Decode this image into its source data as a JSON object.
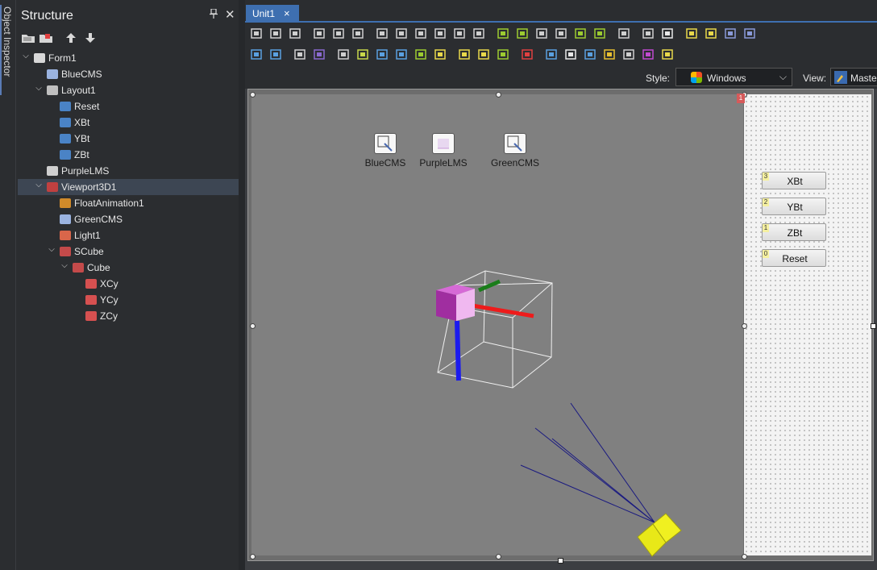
{
  "side_strip": {
    "label": "Object Inspector"
  },
  "structure": {
    "title": "Structure",
    "pin_icon": "pin-icon",
    "close_icon": "close-icon",
    "toolbar": [
      "open-folder-icon",
      "folder-props-icon",
      "move-up-icon",
      "move-down-icon"
    ],
    "tree": [
      {
        "label": "Form1",
        "level": 0,
        "expand": "open",
        "icon": "form-icon",
        "color": "#d8d8d8"
      },
      {
        "label": "BlueCMS",
        "level": 1,
        "expand": "none",
        "icon": "cms-icon",
        "color": "#9ab3e0"
      },
      {
        "label": "Layout1",
        "level": 1,
        "expand": "open",
        "icon": "layout-icon",
        "color": "#bfbfbf"
      },
      {
        "label": "Reset",
        "level": 2,
        "expand": "none",
        "icon": "button-icon",
        "color": "#4a83c6"
      },
      {
        "label": "XBt",
        "level": 2,
        "expand": "none",
        "icon": "button-icon",
        "color": "#4a83c6"
      },
      {
        "label": "YBt",
        "level": 2,
        "expand": "none",
        "icon": "button-icon",
        "color": "#4a83c6"
      },
      {
        "label": "ZBt",
        "level": 2,
        "expand": "none",
        "icon": "button-icon",
        "color": "#4a83c6"
      },
      {
        "label": "PurpleLMS",
        "level": 1,
        "expand": "none",
        "icon": "checker-icon",
        "color": "#cfcfcf"
      },
      {
        "label": "Viewport3D1",
        "level": 1,
        "expand": "open",
        "icon": "viewport-icon",
        "color": "#c04040",
        "selected": true
      },
      {
        "label": "FloatAnimation1",
        "level": 2,
        "expand": "none",
        "icon": "animation-icon",
        "color": "#d08a2a"
      },
      {
        "label": "GreenCMS",
        "level": 2,
        "expand": "none",
        "icon": "cms-icon",
        "color": "#9ab3e0"
      },
      {
        "label": "Light1",
        "level": 2,
        "expand": "none",
        "icon": "light-icon",
        "color": "#d9664a"
      },
      {
        "label": "SCube",
        "level": 2,
        "expand": "open",
        "icon": "sphere-icon",
        "color": "#c44a4a"
      },
      {
        "label": "Cube",
        "level": 3,
        "expand": "open",
        "icon": "cube-icon",
        "color": "#c44a4a"
      },
      {
        "label": "XCy",
        "level": 4,
        "expand": "none",
        "icon": "cube-icon",
        "color": "#d65050"
      },
      {
        "label": "YCy",
        "level": 4,
        "expand": "none",
        "icon": "cube-icon",
        "color": "#d65050"
      },
      {
        "label": "ZCy",
        "level": 4,
        "expand": "none",
        "icon": "cube-icon",
        "color": "#d65050"
      }
    ]
  },
  "editor": {
    "tab": {
      "label": "Unit1",
      "close": "×"
    },
    "toolbar_row1": [
      {
        "name": "align-left-icon",
        "color": "#cfcfcf"
      },
      {
        "name": "align-right-icon",
        "color": "#cfcfcf"
      },
      {
        "name": "align-center-icon",
        "color": "#cfcfcf"
      },
      {
        "name": "align-top-icon",
        "color": "#cfcfcf"
      },
      {
        "name": "align-bottom-icon",
        "color": "#cfcfcf"
      },
      {
        "name": "align-middle-icon",
        "color": "#cfcfcf"
      },
      {
        "name": "space-h-icon",
        "color": "#cfcfcf"
      },
      {
        "name": "space-h-inc-icon",
        "color": "#cfcfcf"
      },
      {
        "name": "space-h-dec-icon",
        "color": "#cfcfcf"
      },
      {
        "name": "space-v-icon",
        "color": "#cfcfcf"
      },
      {
        "name": "space-v-inc-icon",
        "color": "#cfcfcf"
      },
      {
        "name": "space-v-dec-icon",
        "color": "#cfcfcf"
      },
      {
        "name": "size-width-icon",
        "color": "#9ccc30"
      },
      {
        "name": "size-height-icon",
        "color": "#9ccc30"
      },
      {
        "name": "grow-icon",
        "color": "#cfcfcf"
      },
      {
        "name": "shrink-icon",
        "color": "#cfcfcf"
      },
      {
        "name": "center-h-icon",
        "color": "#9ccc30"
      },
      {
        "name": "center-v-icon",
        "color": "#9ccc30"
      },
      {
        "name": "align-grid-icon",
        "color": "#cfcfcf"
      },
      {
        "name": "bring-front-icon",
        "color": "#cfcfcf"
      },
      {
        "name": "gear-icon",
        "color": "#e8e8e8"
      },
      {
        "name": "lock-controls-icon",
        "color": "#e8d84a"
      },
      {
        "name": "snap-icon",
        "color": "#e8d84a"
      },
      {
        "name": "send-back-icon",
        "color": "#8a9ad8"
      },
      {
        "name": "tab-order-icon",
        "color": "#8a9ad8"
      }
    ],
    "toolbar_row2": [
      {
        "name": "select-icon",
        "color": "#5aa0e0"
      },
      {
        "name": "frame-icon",
        "color": "#5aa0e0"
      },
      {
        "name": "grid-icon",
        "color": "#cfcfcf"
      },
      {
        "name": "grid-color-icon",
        "color": "#8a6ad0"
      },
      {
        "name": "image-icon",
        "color": "#cfcfcf"
      },
      {
        "name": "fill-icon",
        "color": "#c8d84a"
      },
      {
        "name": "copy-icon",
        "color": "#5aa0e0"
      },
      {
        "name": "components-icon",
        "color": "#5aa0e0"
      },
      {
        "name": "frame-select-icon",
        "color": "#9ccc30"
      },
      {
        "name": "tiles-icon",
        "color": "#e8d84a"
      },
      {
        "name": "network-icon",
        "color": "#e8d84a"
      },
      {
        "name": "paint-icon",
        "color": "#e8d84a"
      },
      {
        "name": "wire-icon",
        "color": "#9ccc30"
      },
      {
        "name": "play-icon",
        "color": "#e04040"
      },
      {
        "name": "device-icon",
        "color": "#5aa0e0"
      },
      {
        "name": "record-icon",
        "color": "#e8e8e8"
      },
      {
        "name": "folder-eye-icon",
        "color": "#5aa0e0"
      },
      {
        "name": "anchor-icon",
        "color": "#e8c030"
      },
      {
        "name": "layers-icon",
        "color": "#cfcfcf"
      },
      {
        "name": "list-icon",
        "color": "#c04ad0"
      },
      {
        "name": "dollar-icon",
        "color": "#e8d84a"
      }
    ],
    "style_label": "Style:",
    "style_value": "Windows",
    "view_label": "View:",
    "view_value": "Master"
  },
  "canvas": {
    "nonvisual": [
      {
        "label": "BlueCMS",
        "icon": "cms-icon"
      },
      {
        "label": "PurpleLMS",
        "icon": "checker-icon"
      },
      {
        "label": "GreenCMS",
        "icon": "cms-icon"
      }
    ],
    "buttons": [
      {
        "label": "XBt",
        "badge": "3"
      },
      {
        "label": "YBt",
        "badge": "2"
      },
      {
        "label": "ZBt",
        "badge": "1"
      },
      {
        "label": "Reset",
        "badge": "0"
      }
    ],
    "corner_badge": "1",
    "scene_colors": {
      "x_axis": "#ee1b1b",
      "y_axis": "#1a7d1a",
      "z_axis": "#1b1bee",
      "cube": "#b03aaf",
      "light": "#f0f020",
      "light_rays": "#1a1a80"
    }
  }
}
